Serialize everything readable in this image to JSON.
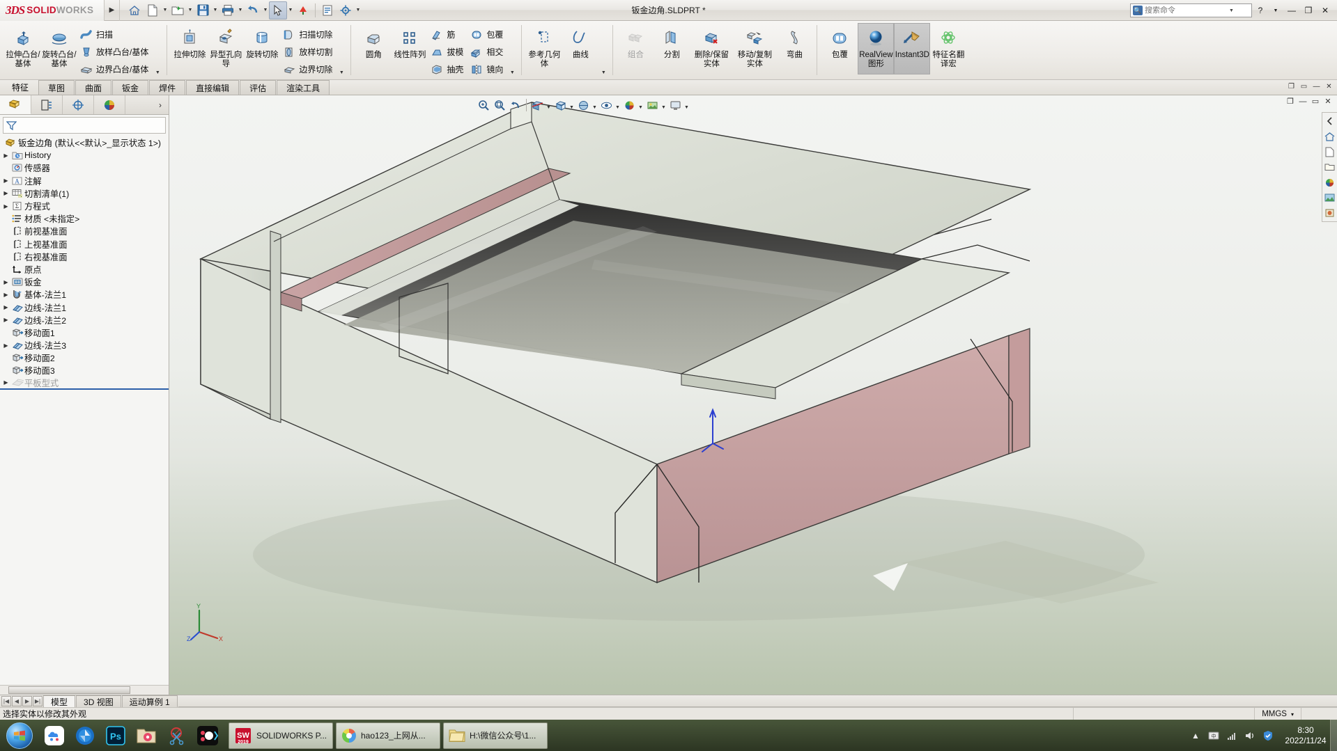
{
  "titlebar": {
    "brand_ds": "3DS",
    "brand_bold": "SOLID",
    "brand_light": "WORKS",
    "document_title": "钣金边角.SLDPRT *",
    "quick_access": [
      {
        "name": "home-icon",
        "label": "主页"
      },
      {
        "name": "new-document-icon",
        "label": "新建"
      },
      {
        "name": "open-folder-icon",
        "label": "打开"
      },
      {
        "name": "save-icon",
        "label": "保存"
      },
      {
        "name": "print-icon",
        "label": "打印"
      },
      {
        "name": "undo-icon",
        "label": "撤销"
      },
      {
        "name": "select-cursor-icon",
        "label": "选择"
      },
      {
        "name": "rebuild-icon",
        "label": "重建模型"
      },
      {
        "name": "file-properties-icon",
        "label": "文件属性"
      },
      {
        "name": "options-gear-icon",
        "label": "选项"
      }
    ],
    "search": {
      "placeholder": "搜索命令",
      "value": ""
    },
    "right_icons": [
      "help-icon",
      "expand-icon"
    ],
    "window_buttons": [
      "minimize",
      "restore",
      "close"
    ]
  },
  "ribbon": {
    "groups": [
      {
        "name": "features-boss",
        "big": [
          {
            "label": "拉伸凸台/基体",
            "icon": "extrude-boss-icon",
            "dropdown": false
          },
          {
            "label": "旋转凸台/基体",
            "icon": "revolve-boss-icon",
            "dropdown": false
          }
        ],
        "small": [
          {
            "label": "扫描",
            "icon": "sweep-icon"
          },
          {
            "label": "放样凸台/基体",
            "icon": "loft-icon"
          },
          {
            "label": "边界凸台/基体",
            "icon": "boundary-boss-icon"
          }
        ]
      },
      {
        "name": "features-cut",
        "big": [
          {
            "label": "拉伸切除",
            "icon": "extrude-cut-icon"
          },
          {
            "label": "异型孔向导",
            "icon": "hole-wizard-icon"
          },
          {
            "label": "旋转切除",
            "icon": "revolve-cut-icon"
          }
        ],
        "small": [
          {
            "label": "扫描切除",
            "icon": "swept-cut-icon"
          },
          {
            "label": "放样切割",
            "icon": "lofted-cut-icon"
          },
          {
            "label": "边界切除",
            "icon": "boundary-cut-icon"
          }
        ]
      },
      {
        "name": "features-modify",
        "big": [
          {
            "label": "圆角",
            "icon": "fillet-icon"
          },
          {
            "label": "线性阵列",
            "icon": "linear-pattern-icon"
          }
        ],
        "small": [
          {
            "label": "筋",
            "icon": "rib-icon"
          },
          {
            "label": "拔模",
            "icon": "draft-icon"
          },
          {
            "label": "抽壳",
            "icon": "shell-icon"
          }
        ],
        "small2": [
          {
            "label": "包覆",
            "icon": "wrap-icon"
          },
          {
            "label": "相交",
            "icon": "intersect-icon"
          },
          {
            "label": "镜向",
            "icon": "mirror-icon"
          }
        ]
      },
      {
        "name": "reference-geometry",
        "big": [
          {
            "label": "参考几何体",
            "icon": "reference-geometry-icon"
          },
          {
            "label": "曲线",
            "icon": "curves-icon"
          }
        ]
      },
      {
        "name": "bodies",
        "big": [
          {
            "label": "组合",
            "icon": "combine-icon",
            "disabled": true
          },
          {
            "label": "分割",
            "icon": "split-icon"
          },
          {
            "label": "删除/保留实体",
            "icon": "delete-keep-body-icon"
          },
          {
            "label": "移动/复制实体",
            "icon": "move-copy-body-icon"
          },
          {
            "label": "弯曲",
            "icon": "flex-icon"
          }
        ]
      },
      {
        "name": "display",
        "big": [
          {
            "label": "包覆",
            "icon": "wrap2-icon"
          },
          {
            "label": "RealView 图形",
            "icon": "realview-sphere-icon",
            "active": true
          },
          {
            "label": "Instant3D",
            "icon": "instant3d-icon",
            "active": true
          },
          {
            "label": "特征名翻译宏",
            "icon": "macro-icon"
          }
        ]
      }
    ]
  },
  "command_tabs": {
    "items": [
      "特征",
      "草图",
      "曲面",
      "钣金",
      "焊件",
      "直接编辑",
      "评估",
      "渲染工具"
    ],
    "active_index": 0
  },
  "left_panel": {
    "tabs": [
      {
        "name": "feature-manager-tab",
        "label": "FeatureManager 设计树",
        "active": true
      },
      {
        "name": "property-manager-tab",
        "label": "PropertyManager"
      },
      {
        "name": "configuration-manager-tab",
        "label": "ConfigurationManager"
      },
      {
        "name": "display-manager-tab",
        "label": "DisplayManager"
      }
    ],
    "more_label": "›",
    "filter_placeholder": "",
    "tree": [
      {
        "label": "钣金边角  (默认<<默认>_显示状态 1>)",
        "icon": "part-icon",
        "indent": 0,
        "expandable": false,
        "root": true
      },
      {
        "label": "History",
        "icon": "history-icon",
        "indent": 1,
        "expandable": true
      },
      {
        "label": "传感器",
        "icon": "sensors-icon",
        "indent": 1,
        "expandable": false
      },
      {
        "label": "注解",
        "icon": "annotations-icon",
        "indent": 1,
        "expandable": true
      },
      {
        "label": "切割清单(1)",
        "icon": "cutlist-icon",
        "indent": 1,
        "expandable": true
      },
      {
        "label": "方程式",
        "icon": "equations-icon",
        "indent": 1,
        "expandable": true
      },
      {
        "label": "材质 <未指定>",
        "icon": "material-icon",
        "indent": 1,
        "expandable": false
      },
      {
        "label": "前视基准面",
        "icon": "plane-icon",
        "indent": 1,
        "expandable": false
      },
      {
        "label": "上视基准面",
        "icon": "plane-icon",
        "indent": 1,
        "expandable": false
      },
      {
        "label": "右视基准面",
        "icon": "plane-icon",
        "indent": 1,
        "expandable": false
      },
      {
        "label": "原点",
        "icon": "origin-icon",
        "indent": 1,
        "expandable": false
      },
      {
        "label": "钣金",
        "icon": "sheetmetal-icon",
        "indent": 1,
        "expandable": true
      },
      {
        "label": "基体-法兰1",
        "icon": "base-flange-icon",
        "indent": 1,
        "expandable": true
      },
      {
        "label": "边线-法兰1",
        "icon": "edge-flange-icon",
        "indent": 1,
        "expandable": true
      },
      {
        "label": "边线-法兰2",
        "icon": "edge-flange-icon",
        "indent": 1,
        "expandable": true
      },
      {
        "label": "移动面1",
        "icon": "move-face-icon",
        "indent": 1,
        "expandable": false
      },
      {
        "label": "边线-法兰3",
        "icon": "edge-flange-icon",
        "indent": 1,
        "expandable": true
      },
      {
        "label": "移动面2",
        "icon": "move-face-icon",
        "indent": 1,
        "expandable": false
      },
      {
        "label": "移动面3",
        "icon": "move-face-icon",
        "indent": 1,
        "expandable": false
      },
      {
        "label": "平板型式",
        "icon": "flat-pattern-icon",
        "indent": 1,
        "expandable": true,
        "dim": true
      }
    ]
  },
  "view_toolbar": {
    "buttons": [
      {
        "name": "zoom-to-fit-icon"
      },
      {
        "name": "zoom-to-area-icon"
      },
      {
        "name": "previous-view-icon"
      },
      {
        "name": "section-view-icon"
      },
      {
        "name": "view-orientation-icon"
      },
      {
        "name": "display-style-icon"
      },
      {
        "name": "hide-show-items-icon"
      },
      {
        "name": "edit-appearance-icon"
      },
      {
        "name": "apply-scene-icon"
      },
      {
        "name": "view-settings-icon"
      }
    ]
  },
  "right_rail": {
    "icons": [
      "display-pane-arrow-icon",
      "home-view-icon",
      "new-document-icon",
      "open-icon",
      "appearance-icon",
      "scene-icon",
      "decal-icon"
    ]
  },
  "graphics": {
    "window_buttons": [
      "minimize",
      "restore",
      "close"
    ],
    "triad_labels": {
      "x": "X",
      "y": "Y",
      "z": "Z"
    }
  },
  "bottom_tabs": {
    "nav_buttons": [
      "|◀",
      "◀",
      "▶",
      "▶|"
    ],
    "items": [
      "模型",
      "3D 视图",
      "运动算例 1"
    ],
    "active_index": 0
  },
  "statusbar": {
    "message": "选择实体以修改其外观",
    "units": "MMGS",
    "units_caret": "▾"
  },
  "taskbar": {
    "quick_launch": [
      {
        "name": "baidu-netdisk-icon"
      },
      {
        "name": "camera-shutter-icon"
      },
      {
        "name": "photoshop-icon",
        "label": "Ps"
      },
      {
        "name": "media-folder-icon"
      },
      {
        "name": "snip-tool-icon"
      },
      {
        "name": "obs-icon"
      }
    ],
    "tasks": [
      {
        "name": "solidworks-task",
        "label": "SOLIDWORKS P...",
        "icon": "solidworks-icon",
        "badge": "2019",
        "active": true
      },
      {
        "name": "browser-task",
        "label": "hao123_上网从...",
        "icon": "chrome-icon"
      },
      {
        "name": "explorer-task",
        "label": "H:\\微信公众号\\1...",
        "icon": "folder-icon"
      }
    ],
    "tray_icons": [
      "show-hidden-icon",
      "ime-icon",
      "network-icon",
      "volume-icon",
      "security-icon"
    ],
    "clock": {
      "time": "8:30",
      "date": "2022/11/24"
    }
  },
  "colors": {
    "brand_red": "#c8102e",
    "accent_blue": "#2b5fa8",
    "ribbon_bg": "#eeece8",
    "panel_bg": "#f5f5f3",
    "model_face_light": "#d8dcd2",
    "model_face_pink": "#c9a7a7",
    "model_interior_dark": "#3a3a38",
    "taskbar_green": "#3c4b2d"
  }
}
